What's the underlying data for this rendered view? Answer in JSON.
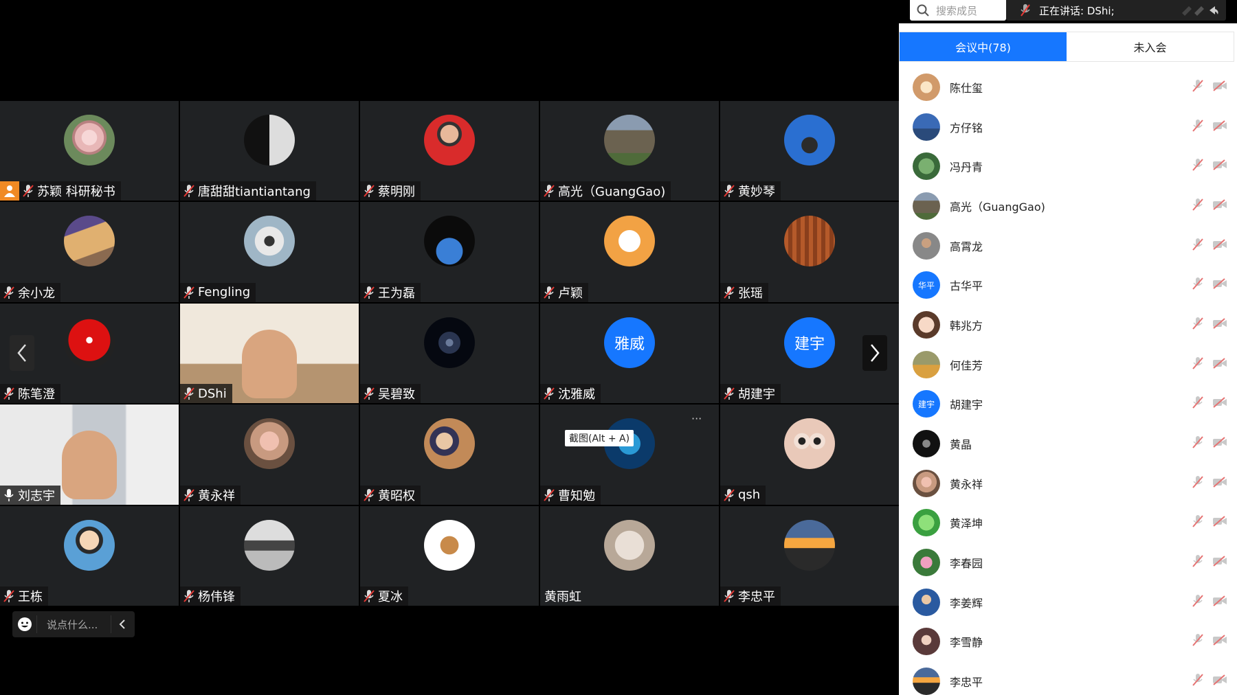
{
  "search": {
    "placeholder": "搜索成员"
  },
  "speaking": {
    "text": "正在讲话: DShi;"
  },
  "tabs": {
    "in_meeting": "会议中(78)",
    "not_joined": "未入会"
  },
  "chat": {
    "placeholder": "说点什么..."
  },
  "tooltip": {
    "text": "截图(Alt + A)"
  },
  "more_label": "···",
  "colors": {
    "accent": "#1677ff",
    "host": "#f08a24",
    "speaking": "#22c55e"
  },
  "tiles": [
    {
      "name": "苏颖 科研秘书",
      "host": true,
      "avatar": "rose"
    },
    {
      "name": "唐甜甜tiantiantang",
      "avatar": "yinyang"
    },
    {
      "name": "蔡明刚",
      "avatar": "person-red"
    },
    {
      "name": "高光（GuangGao)",
      "avatar": "building"
    },
    {
      "name": "黄妙琴",
      "avatar": "poster"
    },
    {
      "name": "余小龙",
      "avatar": "pyramid"
    },
    {
      "name": "Fengling",
      "avatar": "beach"
    },
    {
      "name": "王为磊",
      "avatar": "planet"
    },
    {
      "name": "卢颖",
      "avatar": "cartoon"
    },
    {
      "name": "张瑶",
      "avatar": "wood"
    },
    {
      "name": "陈笔澄",
      "avatar": "red-figure"
    },
    {
      "name": "DShi",
      "avatar": "video-room",
      "video": true,
      "speaking": true
    },
    {
      "name": "吴碧致",
      "avatar": "galaxy"
    },
    {
      "name": "沈雅威",
      "avatar_text": "雅威"
    },
    {
      "name": "胡建宇",
      "avatar_text": "建宇"
    },
    {
      "name": "刘志宇",
      "avatar": "video-office",
      "video": true,
      "mic_on": true
    },
    {
      "name": "黄永祥",
      "avatar": "baby"
    },
    {
      "name": "黄昭权",
      "avatar": "family"
    },
    {
      "name": "曹知勉",
      "avatar": "ocean"
    },
    {
      "name": "qsh",
      "avatar": "doll"
    },
    {
      "name": "王栋",
      "avatar": "boy-glasses"
    },
    {
      "name": "杨伟锋",
      "avatar": "cranes"
    },
    {
      "name": "夏冰",
      "avatar": "toy"
    },
    {
      "name": "黄雨虹",
      "avatar": "cat",
      "no_mic": true
    },
    {
      "name": "李忠平",
      "avatar": "sunset"
    }
  ],
  "members": [
    {
      "name": "陈仕玺",
      "avatar": "drawing"
    },
    {
      "name": "方仔铭",
      "avatar": "sky"
    },
    {
      "name": "冯丹青",
      "avatar": "green"
    },
    {
      "name": "高光（GuangGao)",
      "avatar": "building"
    },
    {
      "name": "高霄龙",
      "avatar": "person-grey"
    },
    {
      "name": "古华平",
      "avatar_text": "华平"
    },
    {
      "name": "韩兆方",
      "avatar": "face"
    },
    {
      "name": "何佳芳",
      "avatar": "landscape"
    },
    {
      "name": "胡建宇",
      "avatar_text": "建宇"
    },
    {
      "name": "黄晶",
      "avatar": "dark-circle"
    },
    {
      "name": "黄永祥",
      "avatar": "baby"
    },
    {
      "name": "黄泽坤",
      "avatar": "frog"
    },
    {
      "name": "李春园",
      "avatar": "flower"
    },
    {
      "name": "李姜辉",
      "avatar": "person-blue"
    },
    {
      "name": "李雪静",
      "avatar": "girl"
    },
    {
      "name": "李忠平",
      "avatar": "sunset"
    }
  ]
}
